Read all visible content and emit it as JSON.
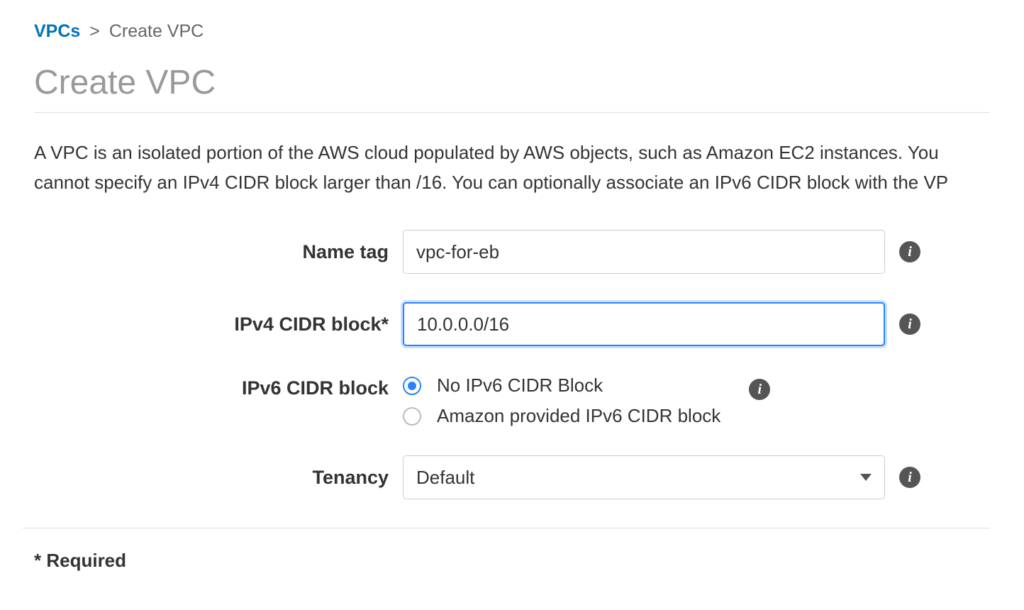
{
  "breadcrumb": {
    "root": "VPCs",
    "sep": ">",
    "current": "Create VPC"
  },
  "title": "Create VPC",
  "description": "A VPC is an isolated portion of the AWS cloud populated by AWS objects, such as Amazon EC2 instances. You cannot specify an IPv4 CIDR block larger than /16. You can optionally associate an IPv6 CIDR block with the VP",
  "form": {
    "name_tag": {
      "label": "Name tag",
      "value": "vpc-for-eb"
    },
    "ipv4_cidr": {
      "label": "IPv4 CIDR block*",
      "value": "10.0.0.0/16"
    },
    "ipv6_cidr": {
      "label": "IPv6 CIDR block",
      "options": {
        "none": "No IPv6 CIDR Block",
        "amazon": "Amazon provided IPv6 CIDR block"
      }
    },
    "tenancy": {
      "label": "Tenancy",
      "value": "Default"
    }
  },
  "info_glyph": "i",
  "required_note": "* Required"
}
